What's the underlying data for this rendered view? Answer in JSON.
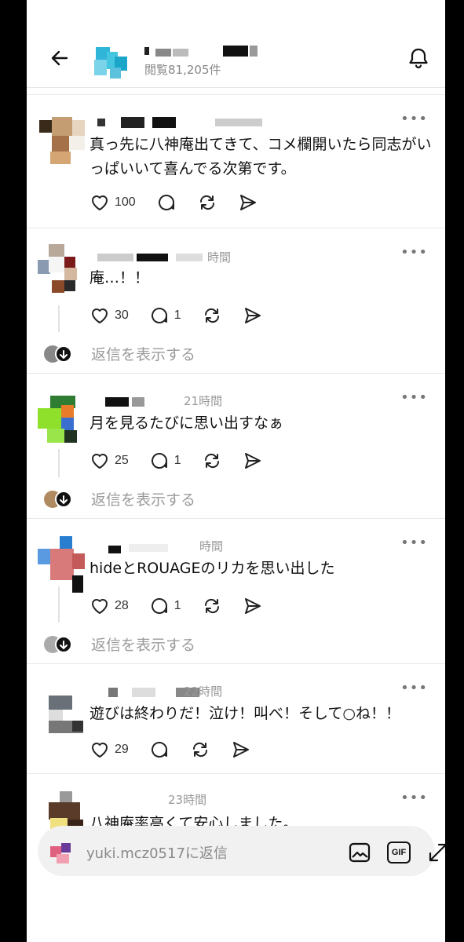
{
  "header": {
    "back_label": "back",
    "views": "閲覧81,205件"
  },
  "comments": [
    {
      "time": "",
      "text": "真っ先に八神庵出てきて、コメ欄開いたら同志がいっぱいいて喜んでる次第です。",
      "likes": "100",
      "replies": "",
      "has_thread": false
    },
    {
      "time": "時間",
      "text": "庵…！！",
      "likes": "30",
      "replies": "1",
      "has_thread": true,
      "show_replies": "返信を表示する"
    },
    {
      "time": "21時間",
      "text": "月を見るたびに思い出すなぁ",
      "likes": "25",
      "replies": "1",
      "has_thread": true,
      "show_replies": "返信を表示する"
    },
    {
      "time": "時間",
      "text": "hideとROUAGEのリカを思い出した",
      "likes": "28",
      "replies": "1",
      "has_thread": true,
      "show_replies": "返信を表示する"
    },
    {
      "time": "22時間",
      "text": "遊びは終わりだ！泣け！叫べ！そして○ね！！",
      "likes": "29",
      "replies": "",
      "has_thread": false
    },
    {
      "time": "23時間",
      "text": "八神庵率高くて安心しました。",
      "likes": "",
      "replies": "",
      "has_thread": false
    }
  ],
  "more_label": "•••",
  "reply_bar": {
    "placeholder": "yuki.mcz0517に返信",
    "gif_label": "GIF"
  }
}
